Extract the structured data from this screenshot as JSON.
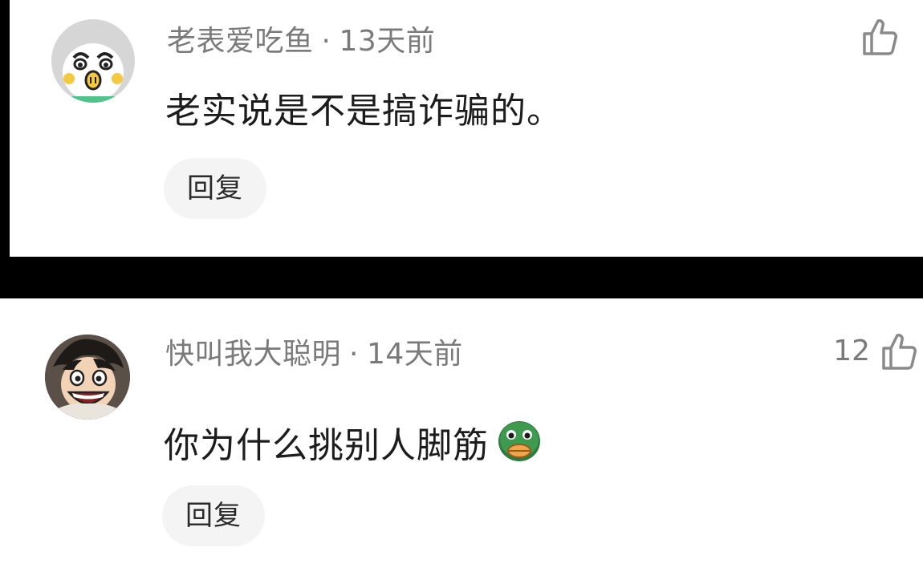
{
  "comments": [
    {
      "username": "老表爱吃鱼",
      "separator": "·",
      "time": "13天前",
      "text": "老实说是不是搞诈骗的。",
      "reply_label": "回复",
      "like_count": "",
      "like_icon": "thumbs-up-icon",
      "avatar_icon": "cartoon-duck-avatar"
    },
    {
      "username": "快叫我大聪明",
      "separator": "·",
      "time": "14天前",
      "text": "你为什么挑别人脚筋",
      "trailing_emoji": "green-duck-emoji",
      "reply_label": "回复",
      "like_count": "12",
      "like_icon": "thumbs-up-icon",
      "avatar_icon": "anime-boy-avatar"
    }
  ],
  "colors": {
    "background": "#000000",
    "card": "#ffffff",
    "meta_text": "#7a7a7a",
    "comment_text": "#1c1c1c",
    "reply_button_bg": "#f4f4f4"
  }
}
